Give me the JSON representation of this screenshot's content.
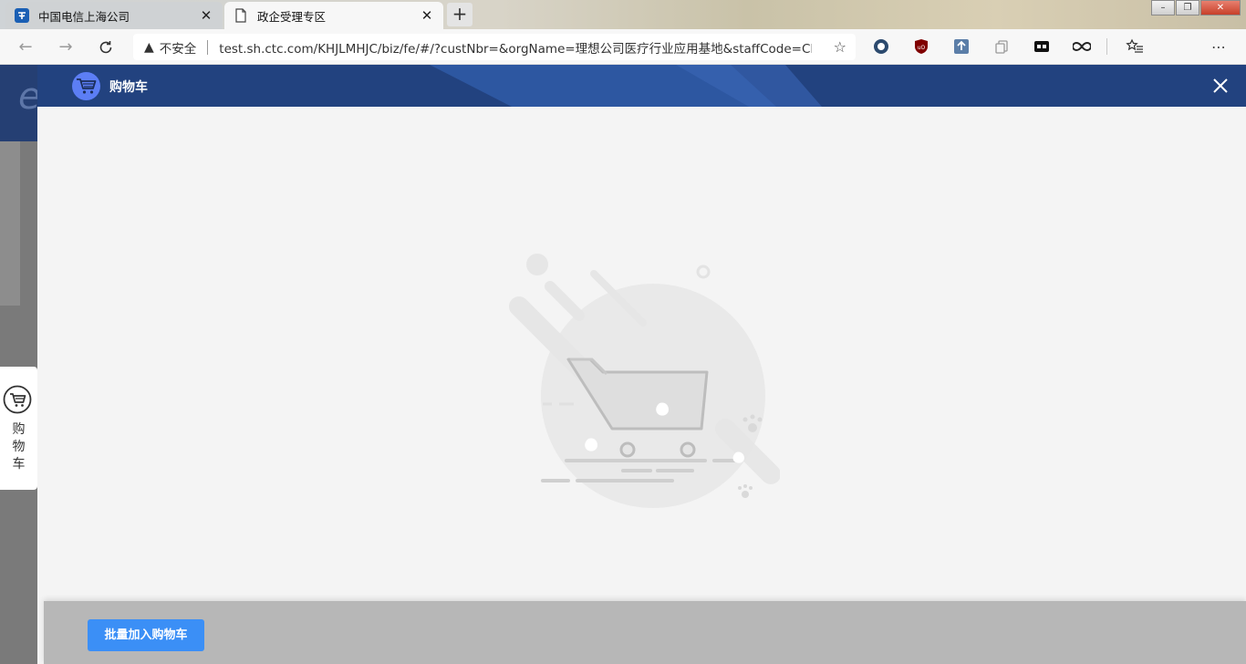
{
  "browser": {
    "tabs": [
      {
        "title": "中国电信上海公司",
        "active": false
      },
      {
        "title": "政企受理专区",
        "active": true
      }
    ],
    "new_tab_label": "+",
    "security_label": "不安全",
    "url": "test.sh.ctc.com/KHJLMHJC/biz/fe/#/?custNbr=&orgName=理想公司医疗行业应用基地&staffCode=CH..."
  },
  "floating_cart": {
    "label": "购物车"
  },
  "drawer": {
    "title": "购物车",
    "footer": {
      "batch_add_label": "批量加入购物车"
    }
  },
  "colors": {
    "header_blue": "#22427f",
    "primary_button": "#3b8ff6",
    "badge_blue": "#5c7ef5"
  },
  "icons": {
    "drawer_header": "shopping-cart-icon",
    "close": "close-icon",
    "empty_state": "empty-cart-illustration"
  }
}
